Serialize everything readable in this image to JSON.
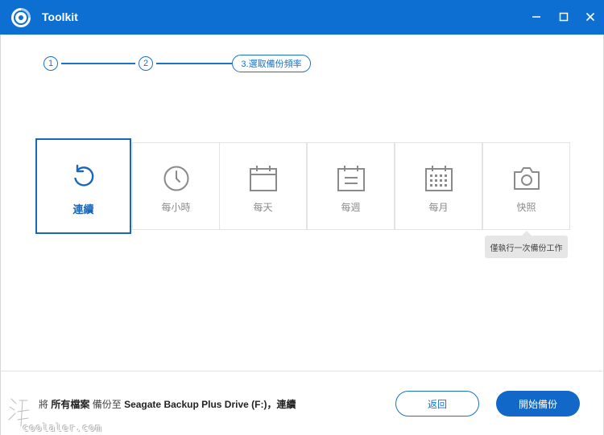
{
  "window": {
    "title": "Toolkit",
    "minimize_icon": "minimize-icon",
    "maximize_icon": "maximize-icon",
    "close_icon": "close-icon",
    "accent": "#0d6fd1"
  },
  "steps": {
    "items": [
      {
        "label": "1"
      },
      {
        "label": "2"
      },
      {
        "label": "3.選取備份頻率",
        "active": true
      }
    ]
  },
  "options": [
    {
      "label": "連續",
      "icon": "continuous-refresh-icon",
      "selected": true
    },
    {
      "label": "每小時",
      "icon": "clock-icon",
      "selected": false
    },
    {
      "label": "每天",
      "icon": "calendar-day-icon",
      "selected": false
    },
    {
      "label": "每週",
      "icon": "calendar-week-icon",
      "selected": false
    },
    {
      "label": "每月",
      "icon": "calendar-month-icon",
      "selected": false
    },
    {
      "label": "快照",
      "icon": "camera-icon",
      "selected": false
    }
  ],
  "tooltip": {
    "text": "僅執行一次備份工作"
  },
  "summary": {
    "prefix": "將",
    "source": "所有檔案",
    "middle": "備份至",
    "destination": "Seagate Backup Plus Drive (F:)",
    "separator": "，",
    "frequency": "連續"
  },
  "buttons": {
    "back_label": "返回",
    "start_label": "開始備份",
    "primary_color": "#1268c8"
  },
  "watermark": {
    "text": "coolaler.com"
  }
}
